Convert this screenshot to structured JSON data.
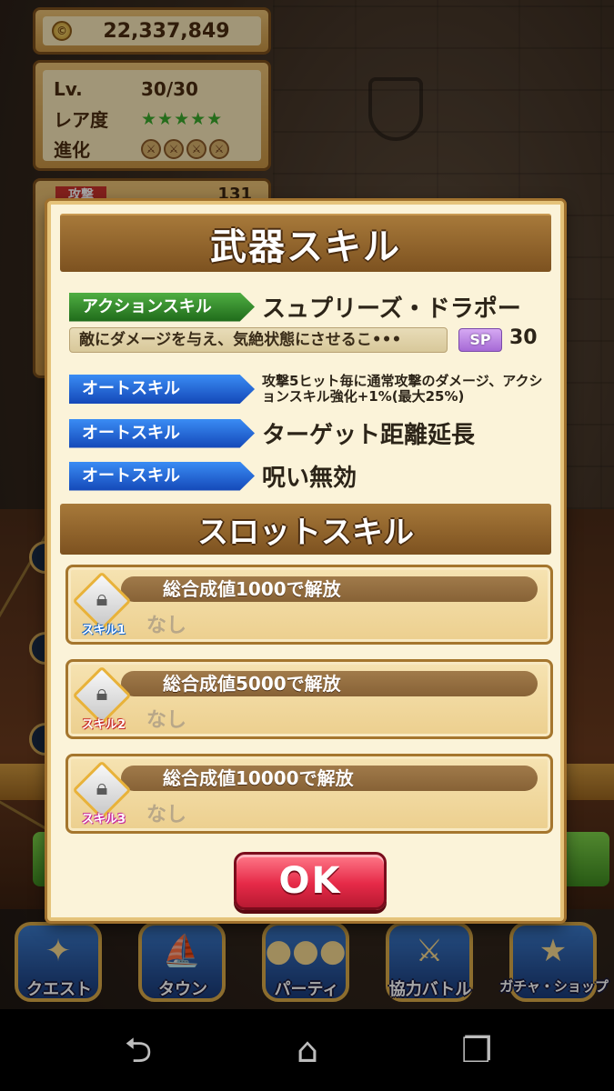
{
  "status": {
    "money": "22,337,849",
    "coin_icon": "coin-icon",
    "level_label": "Lv.",
    "level_value": "30/30",
    "rarity_label": "レア度",
    "rarity_stars": "★★★★★",
    "evolution_label": "進化",
    "attack_label": "攻撃",
    "attack_value": "131"
  },
  "modal": {
    "title": "武器スキル",
    "action_skill": {
      "tag": "アクションスキル",
      "name": "スュプリーズ・ドラポー",
      "description": "敵にダメージを与え、気絶状態にさせるこ•••",
      "sp_label": "SP",
      "sp_value": "30"
    },
    "auto_skills": [
      {
        "tag": "オートスキル",
        "text": "攻撃5ヒット毎に通常攻撃のダメージ、アクションスキル強化+1%(最大25%)"
      },
      {
        "tag": "オートスキル",
        "text": "ターゲット距離延長"
      },
      {
        "tag": "オートスキル",
        "text": "呪い無効"
      }
    ],
    "slot_section_title": "スロットスキル",
    "slots": [
      {
        "badge": "スキル1",
        "condition": "総合成値1000で解放",
        "value": "なし"
      },
      {
        "badge": "スキル2",
        "condition": "総合成値5000で解放",
        "value": "なし"
      },
      {
        "badge": "スキル3",
        "condition": "総合成値10000で解放",
        "value": "なし"
      }
    ],
    "ok_label": "OK"
  },
  "game_nav": [
    {
      "label": "クエスト",
      "icon": "map-icon"
    },
    {
      "label": "タウン",
      "icon": "ship-icon"
    },
    {
      "label": "パーティ",
      "icon": "party-icon"
    },
    {
      "label": "協力バトル",
      "icon": "shield-sword-icon"
    },
    {
      "label": "ガチャ・ショップ",
      "icon": "star-icon"
    }
  ],
  "system_nav": {
    "back_icon": "back-icon",
    "home_icon": "home-icon",
    "recents_icon": "recents-icon"
  },
  "colors": {
    "panel_brown": "#7d5220",
    "action_green": "#1f6a1a",
    "auto_blue": "#1448b8",
    "ok_red": "#e62a48",
    "sp_purple": "#a66ad6"
  }
}
